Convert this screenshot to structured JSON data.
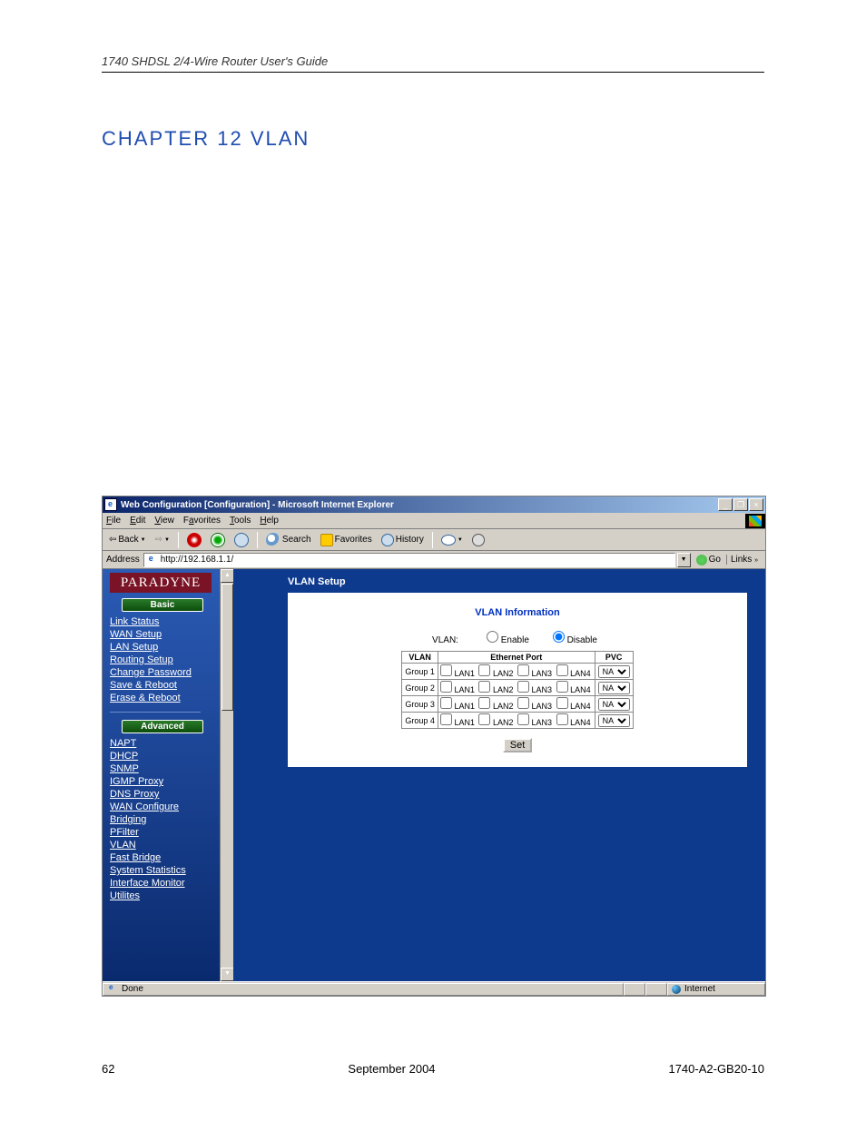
{
  "doc_header": "1740 SHDSL 2/4-Wire Router User's Guide",
  "chapter": "CHAPTER 12   VLAN",
  "footer": {
    "page": "62",
    "date": "September 2004",
    "docnum": "1740-A2-GB20-10"
  },
  "browser": {
    "title": "Web Configuration [Configuration] - Microsoft Internet Explorer",
    "menus": {
      "file": "File",
      "edit": "Edit",
      "view": "View",
      "favorites": "Favorites",
      "tools": "Tools",
      "help": "Help"
    },
    "tb": {
      "back": "Back",
      "search": "Search",
      "favorites": "Favorites",
      "history": "History"
    },
    "addr": {
      "label": "Address",
      "url": "http://192.168.1.1/",
      "go": "Go",
      "links": "Links"
    },
    "status": {
      "done": "Done",
      "internet": "Internet"
    }
  },
  "sidebar": {
    "logo": "PARADYNE",
    "basic_hdr": "Basic",
    "basic": {
      "link_status": "Link Status",
      "wan_setup": "WAN Setup",
      "lan_setup": "LAN Setup",
      "routing_setup": "Routing Setup",
      "change_password": "Change Password",
      "save_reboot": "Save & Reboot",
      "erase_reboot": "Erase & Reboot"
    },
    "adv_hdr": "Advanced",
    "adv": {
      "napt": "NAPT",
      "dhcp": "DHCP",
      "snmp": "SNMP",
      "igmp_proxy": "IGMP Proxy",
      "dns_proxy": "DNS Proxy",
      "wan_configure": "WAN Configure",
      "bridging": "Bridging",
      "pfilter": "PFilter",
      "vlan": "VLAN",
      "fast_bridge": "Fast Bridge",
      "system_statistics": "System Statistics",
      "interface_monitor": "Interface Monitor",
      "utilities": "Utilites"
    }
  },
  "vlan": {
    "setup_title": "VLAN Setup",
    "panel_title": "VLAN Information",
    "label": "VLAN:",
    "enable": "Enable",
    "disable": "Disable",
    "col_vlan": "VLAN",
    "col_eth": "Ethernet Port",
    "col_pvc": "PVC",
    "groups": {
      "g1": "Group 1",
      "g2": "Group 2",
      "g3": "Group 3",
      "g4": "Group 4"
    },
    "lans": {
      "l1": "LAN1",
      "l2": "LAN2",
      "l3": "LAN3",
      "l4": "LAN4"
    },
    "pvc_default": "NA",
    "set_btn": "Set"
  }
}
